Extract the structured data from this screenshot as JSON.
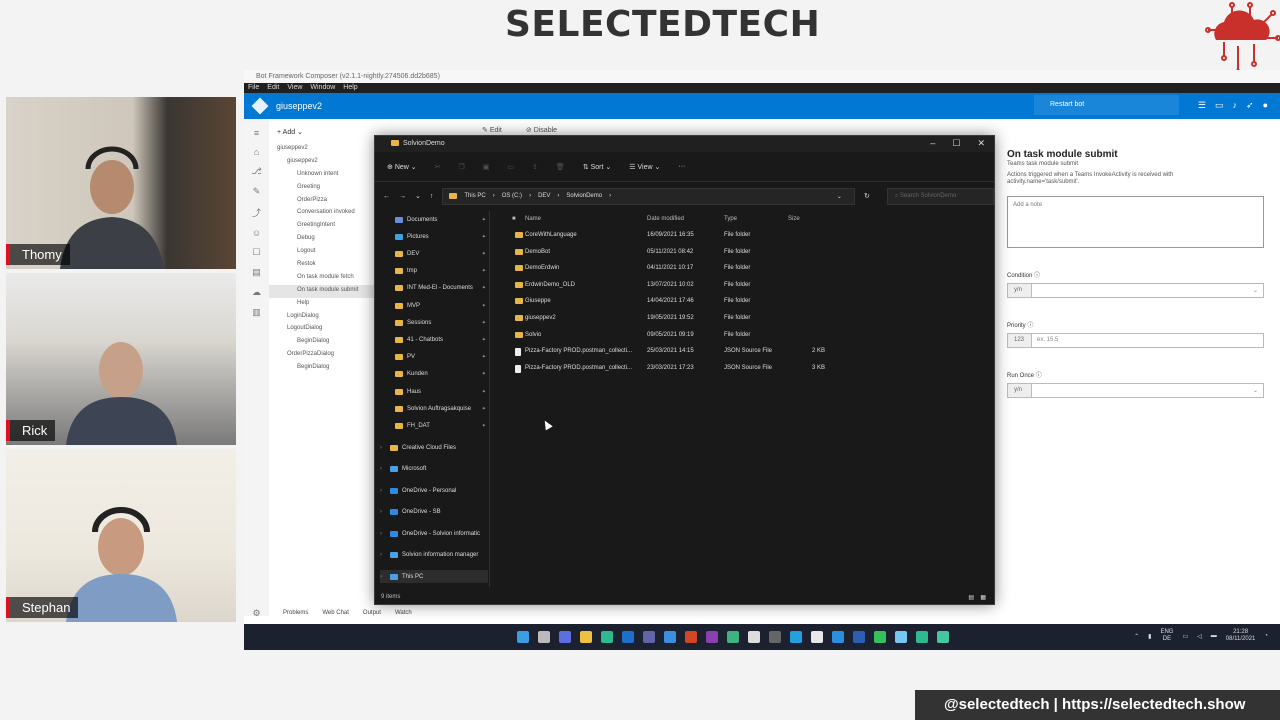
{
  "stream": {
    "brand_title": "SELECTEDTECH",
    "logo_text": "SelectedTech",
    "footer": "@selectedtech | https://selectedtech.show",
    "participants": [
      "Thomy",
      "Rick",
      "Stephan"
    ]
  },
  "composer": {
    "window_title": "Bot Framework Composer (v2.1.1-nightly.274506.dd2b685)",
    "menu": [
      "File",
      "Edit",
      "View",
      "Window",
      "Help"
    ],
    "bot_name": "giuseppev2",
    "restart_label": "Restart bot",
    "add_label": "Add",
    "edit_label": "Edit",
    "disable_label": "Disable",
    "nav": [
      {
        "label": "giuseppev2",
        "level": 0
      },
      {
        "label": "giuseppev2",
        "level": 1
      },
      {
        "label": "Unknown intent",
        "level": 2
      },
      {
        "label": "Greeting",
        "level": 2
      },
      {
        "label": "OrderPizza",
        "level": 2
      },
      {
        "label": "Conversation invoked",
        "level": 2
      },
      {
        "label": "GreetingIntent",
        "level": 2
      },
      {
        "label": "Debug",
        "level": 2
      },
      {
        "label": "Logout",
        "level": 2
      },
      {
        "label": "Restok",
        "level": 2
      },
      {
        "label": "On task module fetch",
        "level": 2
      },
      {
        "label": "On task module submit",
        "level": 2
      },
      {
        "label": "Help",
        "level": 2
      },
      {
        "label": "LoginDialog",
        "level": 1
      },
      {
        "label": "LogoutDialog",
        "level": 1
      },
      {
        "label": "BeginDialog",
        "level": 2
      },
      {
        "label": "OrderPizzaDialog",
        "level": 1
      },
      {
        "label": "BeginDialog",
        "level": 2
      }
    ],
    "bottom_tabs": [
      "Problems",
      "Web Chat",
      "Output",
      "Watch"
    ],
    "properties": {
      "title": "On task module submit",
      "subtitle": "Teams task module submit",
      "description": "Actions triggered when a Teams InvokeActivity is received with activity.name='task/submit'.",
      "note_placeholder": "Add a note",
      "condition_label": "Condition",
      "condition_tag": "y/n",
      "priority_label": "Priority",
      "priority_tag": "123",
      "priority_placeholder": "ex. 15.5",
      "run_once_label": "Run Once",
      "run_once_tag": "y/n"
    },
    "taskbar": {
      "language": "ENG",
      "locale": "DE",
      "time": "21:28",
      "date": "08/11/2021"
    }
  },
  "explorer": {
    "title": "SolvionDemo",
    "commands": {
      "new": "New",
      "sort": "Sort",
      "view": "View"
    },
    "breadcrumb": [
      "This PC",
      "OS (C:)",
      "DEV",
      "SolvionDemo"
    ],
    "search_placeholder": "Search SolvionDemo",
    "quick_access": [
      "Documents",
      "Pictures",
      "DEV",
      "tmp",
      "INT Med-El - Documents",
      "MVP",
      "Sessions",
      "41 - Chatbots",
      "PV",
      "Kunden",
      "Haus",
      "Solvion Auftragsakquise",
      "FH_DAT"
    ],
    "groups": [
      "Creative Cloud Files",
      "Microsoft",
      "OneDrive - Personal",
      "OneDrive - SB",
      "OneDrive - Solvion informatic",
      "Solvion information manager",
      "This PC"
    ],
    "columns": [
      "Name",
      "Date modified",
      "Type",
      "Size"
    ],
    "files": [
      {
        "name": "CoreWithLanguage",
        "date": "16/09/2021 16:35",
        "type": "File folder",
        "size": "",
        "kind": "folder"
      },
      {
        "name": "DemoBot",
        "date": "05/11/2021 08:42",
        "type": "File folder",
        "size": "",
        "kind": "folder"
      },
      {
        "name": "DemoErdwin",
        "date": "04/11/2021 10:17",
        "type": "File folder",
        "size": "",
        "kind": "folder"
      },
      {
        "name": "ErdwinDemo_OLD",
        "date": "13/07/2021 10:02",
        "type": "File folder",
        "size": "",
        "kind": "folder"
      },
      {
        "name": "Giuseppe",
        "date": "14/04/2021 17:46",
        "type": "File folder",
        "size": "",
        "kind": "folder"
      },
      {
        "name": "giuseppev2",
        "date": "19/05/2021 19:52",
        "type": "File folder",
        "size": "",
        "kind": "folder"
      },
      {
        "name": "Solvio",
        "date": "09/05/2021 09:19",
        "type": "File folder",
        "size": "",
        "kind": "folder"
      },
      {
        "name": "Pizza-Factory PROD.postman_collecti...",
        "date": "25/03/2021 14:15",
        "type": "JSON Source File",
        "size": "2 KB",
        "kind": "file"
      },
      {
        "name": "Pizza-Factory PROD.postman_collecti...",
        "date": "23/03/2021 17:23",
        "type": "JSON Source File",
        "size": "3 KB",
        "kind": "file"
      }
    ],
    "status": "9 items"
  }
}
